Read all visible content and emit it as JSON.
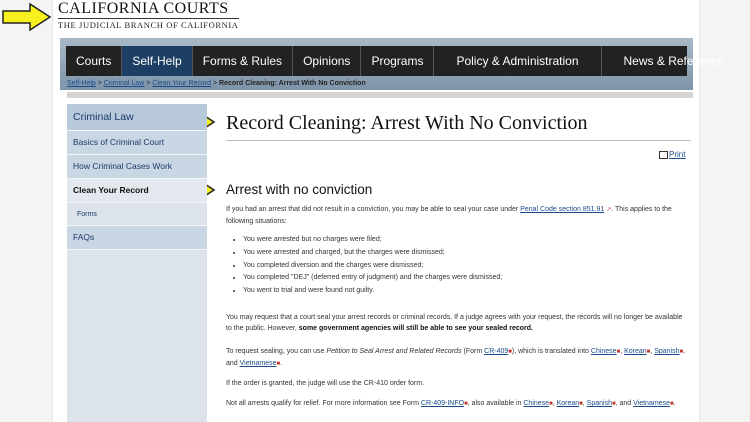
{
  "header": {
    "logo_main": "CALIFORNIA COURTS",
    "logo_sub": "THE JUDICIAL BRANCH OF CALIFORNIA"
  },
  "nav": {
    "items": [
      "Courts",
      "Self-Help",
      "Forms & Rules",
      "Opinions",
      "Programs",
      "Policy & Administration",
      "News & Reference"
    ],
    "active": "Self-Help"
  },
  "breadcrumb": {
    "links": [
      "Self-Help",
      "Criminal Law",
      "Clean Your Record"
    ],
    "separator": ">",
    "current": "Record Cleaning: Arrest With No Conviction"
  },
  "sidebar": {
    "heading": "Criminal Law",
    "items": [
      "Basics of Criminal Court",
      "How Criminal Cases Work",
      "Clean Your Record",
      "Forms",
      "FAQs"
    ]
  },
  "main": {
    "title": "Record Cleaning: Arrest With No Conviction",
    "print_label": "Print",
    "subtitle": "Arrest with no conviction",
    "intro_before_link": "If you had an arrest that did not result in a conviction, you may be able to seal your case under",
    "intro_link": "Penal Code section 851.91",
    "intro_after_link": ". This applies to the following situations:",
    "situations": [
      "You were arrested but no charges were filed;",
      "You were arrested and charged, but the charges were dismissed;",
      "You completed diversion and the charges were dismissed;",
      "You completed \"DEJ\" (deferred entry of judgment) and the charges were dismissed;",
      "You went to trial and were found not guilty."
    ],
    "request_text": "You may request that a court seal your arrest records or criminal records. If a judge agrees with your request, the records will no longer be available to the public. However,",
    "request_bold": "some government agencies will still be able to see your sealed record.",
    "sealing_1": "To request sealing, you can use",
    "sealing_form_title": "Petition to Seal Arrest and Related Records",
    "sealing_2": "(Form",
    "sealing_form_link": "CR-409",
    "sealing_3": "), which is translated into",
    "lang_chinese": "Chinese",
    "lang_korean": "Korean",
    "lang_spanish": "Spanish",
    "lang_vietnamese": "Vietnamese",
    "and_word": "and",
    "granted_text": "If the order is granted, the judge will use the CR-410 order form.",
    "relief_1": "Not all arrests qualify for relief. For more information see Form",
    "relief_link": "CR-409-INFO",
    "relief_2": ", also available in"
  },
  "colors": {
    "nav_bg": "#222222",
    "nav_active": "#1d3f63",
    "sidebar_bg": "#c9d6e3",
    "link": "#1a4a8a",
    "arrow_fill": "#f7ef1e"
  }
}
